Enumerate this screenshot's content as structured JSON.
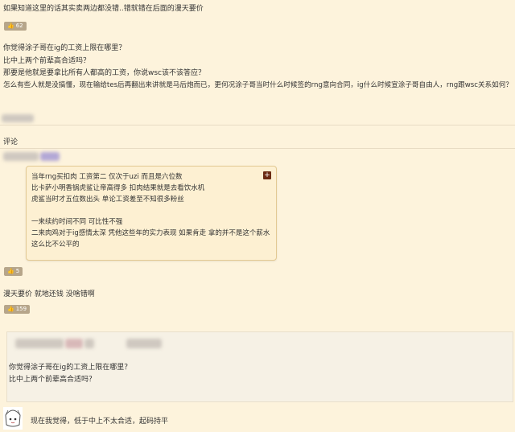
{
  "post1": {
    "text": "如果知道这里的话其实卖两边都没错..错就错在后面的漫天要价",
    "likes": "62"
  },
  "post2": {
    "lines": [
      "你觉得涂子哥在ig的工资上限在哪里？",
      "比中上两个前辈高合适吗？",
      "那要是他就是要拿比所有人都高的工资，你说wsc该不该答应？",
      "怎么有些人就是没搞懂，现在输给tes后再翻出来讲就是马后炮而已，更何况涂子哥当时什么时候签的rng意向合同，ig什么时候宣涂子哥自由人，rng跟wsc关系如何？"
    ]
  },
  "comments": {
    "label": "评论",
    "bubble": {
      "lines": [
        "当年rng买扣肉  工资第二  仅次于uzi  而且是六位数",
        "比卡萨小明香锅虎鲨让帝高得多  扣肉结果就是去看饮水机",
        "虎鲨当时才五位数出头  单论工资差至不知很多粉丝",
        "",
        "一来续约时间不同  可比性不强",
        "二来肉鸡对于ig感情太深  凭他这些年的实力表现  如果肯走  拿的并不是这个薪水",
        "这么比不公平的"
      ],
      "plus": "+",
      "likes": "5"
    }
  },
  "post3": {
    "text": "漫天要价  就地还钱  没啥错啊",
    "likes": "159"
  },
  "quote": {
    "lines": [
      "你觉得涂子哥在ig的工资上限在哪里？",
      "比中上两个前辈高合适吗？"
    ]
  },
  "reply": {
    "text": "现在我觉得，低于中上不太合适，起码持平"
  }
}
